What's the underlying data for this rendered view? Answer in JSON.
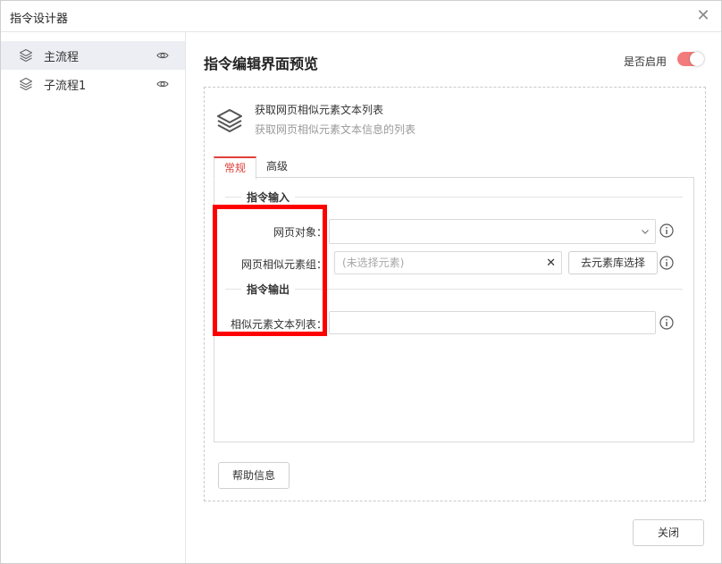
{
  "window": {
    "title": "指令设计器"
  },
  "sidebar": {
    "items": [
      {
        "label": "主流程",
        "active": true
      },
      {
        "label": "子流程1",
        "active": false
      }
    ]
  },
  "main": {
    "title": "指令编辑界面预览",
    "enable_label": "是否启用",
    "enabled": true
  },
  "command": {
    "name": "获取网页相似元素文本列表",
    "description": "获取网页相似元素文本信息的列表"
  },
  "tabs": [
    {
      "label": "常规",
      "active": true
    },
    {
      "label": "高级",
      "active": false
    }
  ],
  "form": {
    "input_section": "指令输入",
    "output_section": "指令输出",
    "web_object_label": "网页对象：",
    "web_object_value": "",
    "similar_group_label": "网页相似元素组：",
    "similar_group_placeholder": "(未选择元素)",
    "library_button": "去元素库选择",
    "output_list_label": "相似元素文本列表：",
    "output_list_value": ""
  },
  "footer": {
    "help_button": "帮助信息",
    "close_button": "关闭"
  },
  "colors": {
    "accent": "#e0403a",
    "toggle_on": "#f27b7b",
    "highlight": "#ff0000",
    "sidebar_active": "#eceef3"
  },
  "icons": {
    "layer": "layers-icon",
    "eye": "eye-icon",
    "close": "close-icon",
    "info": "info-icon",
    "chevron": "chevron-down-icon"
  }
}
